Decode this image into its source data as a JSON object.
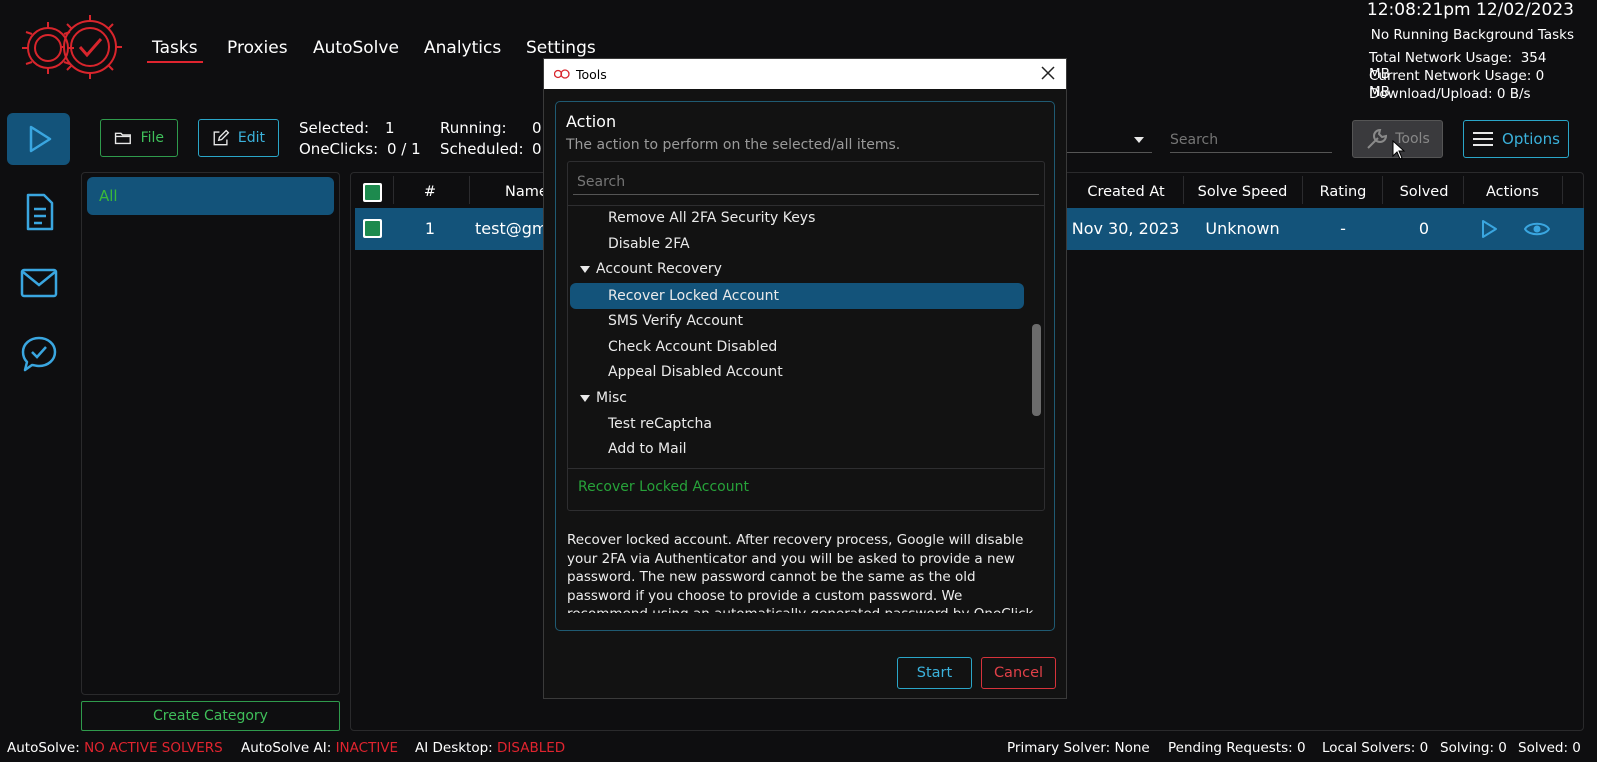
{
  "header": {
    "nav_tabs": [
      {
        "label": "Tasks",
        "active": true
      },
      {
        "label": "Proxies"
      },
      {
        "label": "AutoSolve"
      },
      {
        "label": "Analytics"
      },
      {
        "label": "Settings"
      }
    ],
    "clock": "12:08:21pm 12/02/2023",
    "background_tasks": "No Running Background Tasks",
    "network": {
      "total_label": "Total Network Usage:",
      "total_value": "354 MB",
      "current_label": "Current Network Usage:",
      "current_value": "0 MB",
      "dlul_label": "Download/Upload:",
      "dlul_value": "0 B/s"
    }
  },
  "rail": {
    "items": [
      {
        "icon": "play-icon",
        "active": true
      },
      {
        "icon": "document-icon"
      },
      {
        "icon": "mail-icon"
      },
      {
        "icon": "chat-check-icon"
      }
    ]
  },
  "toolbar": {
    "file_label": "File",
    "edit_label": "Edit",
    "selected_label": "Selected:",
    "selected_value": "1",
    "oneclicks_label": "OneClicks:",
    "oneclicks_value": "0 / 1",
    "running_label": "Running:",
    "running_value": "0",
    "scheduled_label": "Scheduled:",
    "scheduled_value": "0",
    "search_placeholder": "Search",
    "tools_label": "Tools",
    "options_label": "Options"
  },
  "categories": {
    "items": [
      {
        "label": "All"
      }
    ],
    "create_label": "Create Category"
  },
  "table": {
    "columns": [
      "#",
      "Name",
      "Created At",
      "Solve Speed",
      "Rating",
      "Solved",
      "Actions"
    ],
    "rows": [
      {
        "index": "1",
        "name": "test@gm",
        "created_at": "Nov 30, 2023",
        "solve_speed": "Unknown",
        "rating": "-",
        "solved": "0"
      }
    ]
  },
  "modal": {
    "title": "Tools",
    "action_title": "Action",
    "action_desc": "The action to perform on the selected/all items.",
    "search_placeholder": "Search",
    "tree": {
      "items": [
        {
          "type": "item",
          "label": "Remove All 2FA Security Keys"
        },
        {
          "type": "item",
          "label": "Disable 2FA"
        },
        {
          "type": "group",
          "label": "Account Recovery"
        },
        {
          "type": "item",
          "label": "Recover Locked Account",
          "selected": true
        },
        {
          "type": "item",
          "label": "SMS Verify Account"
        },
        {
          "type": "item",
          "label": "Check Account Disabled"
        },
        {
          "type": "item",
          "label": "Appeal Disabled Account"
        },
        {
          "type": "group",
          "label": "Misc"
        },
        {
          "type": "item",
          "label": "Test reCaptcha"
        },
        {
          "type": "item",
          "label": "Add to Mail"
        }
      ]
    },
    "selected_value": "Recover Locked Account",
    "description": "Recover locked account. After recovery process, Google will disable your 2FA via Authenticator and you will be asked to provide a new password. The new password cannot be the same as the old password if you choose to provide a custom password. We recommend using an automatically generated password by OneClick to ensure your",
    "start_label": "Start",
    "cancel_label": "Cancel"
  },
  "statusbar": {
    "autosolve_label": "AutoSolve:",
    "autosolve_value": "NO ACTIVE SOLVERS",
    "autosolve_ai_label": "AutoSolve AI:",
    "autosolve_ai_value": "INACTIVE",
    "ai_desktop_label": "AI Desktop:",
    "ai_desktop_value": "DISABLED",
    "primary_solver": "Primary Solver: None",
    "pending_requests": "Pending Requests: 0",
    "local_solvers": "Local Solvers: 0",
    "solving": "Solving: 0",
    "solved": "Solved: 0"
  },
  "colors": {
    "accent": "#13537a",
    "danger": "#e0242f",
    "success": "#3fbf5a",
    "info": "#3bb2dc"
  }
}
